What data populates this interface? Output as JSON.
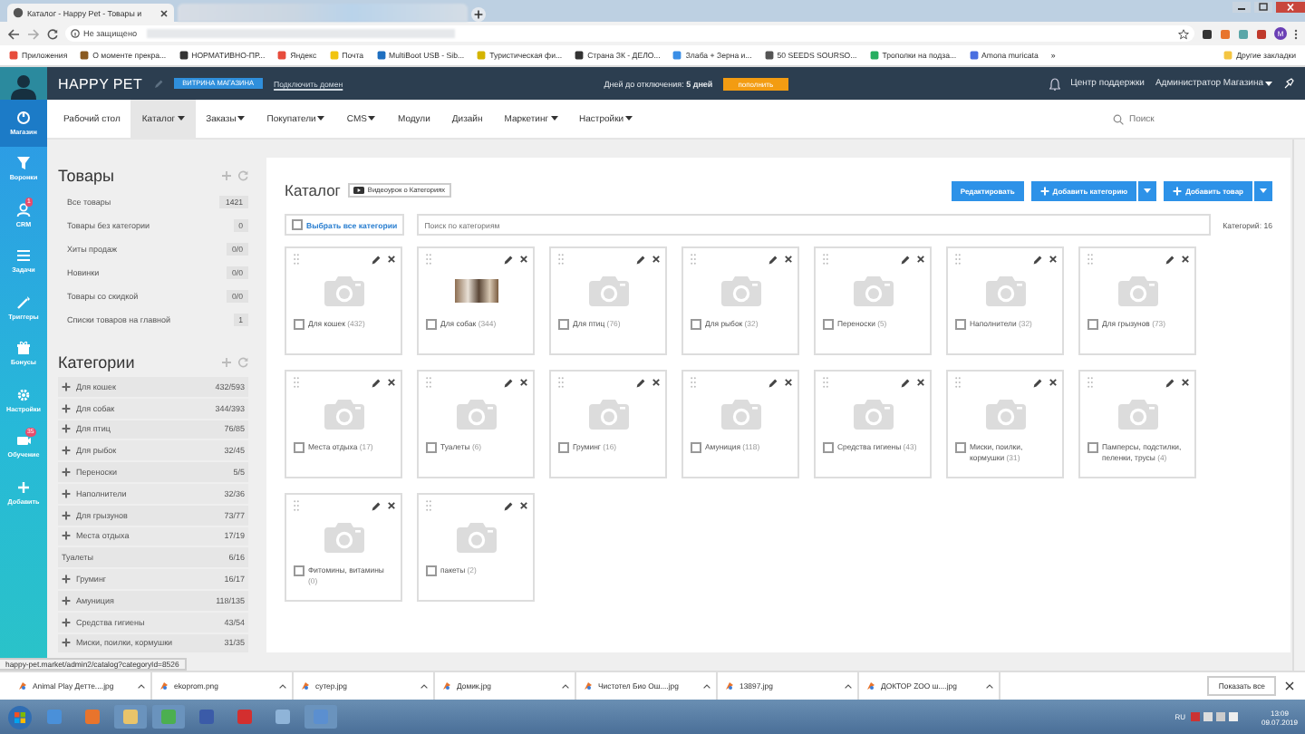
{
  "browser": {
    "tabs": [
      {
        "title": "Каталог - Happy Pet - Товары и",
        "selected": true
      }
    ],
    "security": "Не защищено",
    "profile": "M"
  },
  "bookmarks": [
    "Приложения",
    "О моменте прекра...",
    "НОРМАТИВНО-ПР...",
    "Яндекс",
    "Почта",
    "MultiBoot USB - Sib...",
    "Туристическая фи...",
    "Страна ЗК - ДЕЛО...",
    "Злаба + Зерна и...",
    "50 SEEDS SOURSO...",
    "Трополки на подза...",
    "Amona muricata",
    "»",
    "Другие закладки"
  ],
  "header": {
    "brand": "HAPPY PET",
    "storefront_button": "ВИТРИНА МАГАЗИНА",
    "domain_link": "Подключить домен",
    "days_left": "Дней до отключения: **5 дней**",
    "topup_button": "пополнить",
    "support": "Центр поддержки",
    "user": "Администратор Магазина"
  },
  "sidebar": [
    {
      "label": "Магазин",
      "selected": true
    },
    {
      "label": "Воронки",
      "selected": false
    },
    {
      "label": "CRM",
      "selected": false,
      "badge": "1"
    },
    {
      "label": "Задачи",
      "selected": false
    },
    {
      "label": "Триггеры",
      "selected": false
    },
    {
      "label": "Бонусы",
      "selected": false
    },
    {
      "label": "Настройки",
      "selected": false
    },
    {
      "label": "Обучение",
      "selected": false,
      "badge": "35"
    },
    {
      "label": "Добавить",
      "selected": false
    }
  ],
  "nav": {
    "items": [
      {
        "label": "Рабочий стол",
        "dropdown": false,
        "selected": false
      },
      {
        "label": "Каталог",
        "dropdown": true,
        "selected": true
      },
      {
        "label": "Заказы",
        "dropdown": true,
        "selected": false
      },
      {
        "label": "Покупатели",
        "dropdown": true,
        "selected": false
      },
      {
        "label": "CMS",
        "dropdown": true,
        "selected": false
      },
      {
        "label": "Модули",
        "dropdown": false,
        "selected": false
      },
      {
        "label": "Дизайн",
        "dropdown": false,
        "selected": false
      },
      {
        "label": "Маркетинг",
        "dropdown": true,
        "selected": false
      },
      {
        "label": "Настройки",
        "dropdown": true,
        "selected": false
      }
    ],
    "search_placeholder": "Поиск"
  },
  "products": {
    "title": "Товары",
    "items": [
      {
        "label": "Все товары",
        "count": "1421"
      },
      {
        "label": "Товары без категории",
        "count": "0"
      },
      {
        "label": "Хиты продаж",
        "count": "0/0"
      },
      {
        "label": "Новинки",
        "count": "0/0"
      },
      {
        "label": "Товары со скидкой",
        "count": "0/0"
      },
      {
        "label": "Списки товаров на главной",
        "count": "1"
      }
    ]
  },
  "categories": {
    "title": "Категории",
    "items": [
      {
        "label": "Для кошек",
        "count": "432/593",
        "expandable": true
      },
      {
        "label": "Для собак",
        "count": "344/393",
        "expandable": true
      },
      {
        "label": "Для птиц",
        "count": "76/85",
        "expandable": true
      },
      {
        "label": "Для рыбок",
        "count": "32/45",
        "expandable": true
      },
      {
        "label": "Переноски",
        "count": "5/5",
        "expandable": true
      },
      {
        "label": "Наполнители",
        "count": "32/36",
        "expandable": true
      },
      {
        "label": "Для грызунов",
        "count": "73/77",
        "expandable": true
      },
      {
        "label": "Места отдыха",
        "count": "17/19",
        "expandable": true
      },
      {
        "label": "Туалеты",
        "count": "6/16",
        "expandable": false
      },
      {
        "label": "Груминг",
        "count": "16/17",
        "expandable": true
      },
      {
        "label": "Амуниция",
        "count": "118/135",
        "expandable": true
      },
      {
        "label": "Средства гигиены",
        "count": "43/54",
        "expandable": true
      },
      {
        "label": "Миски, поилки, кормушки",
        "count": "31/35",
        "expandable": true
      }
    ]
  },
  "catalog": {
    "title": "Каталог",
    "video_button": "Видеоурок о Категориях",
    "edit_button": "Редактировать",
    "add_category": "Добавить категорию",
    "add_product": "Добавить товар",
    "select_all": {
      "label": "Выбрать все категории",
      "checked": false
    },
    "search_placeholder": "Поиск по категориям",
    "count_label": "Категорий: 16",
    "cards": [
      {
        "name": "Для кошек",
        "count": "(432)",
        "kind": "placeholder",
        "checked": false
      },
      {
        "name": "Для собак",
        "count": "(344)",
        "kind": "photo",
        "checked": false
      },
      {
        "name": "Для птиц",
        "count": "(76)",
        "kind": "placeholder",
        "checked": false
      },
      {
        "name": "Для рыбок",
        "count": "(32)",
        "kind": "placeholder",
        "checked": false
      },
      {
        "name": "Переноски",
        "count": "(5)",
        "kind": "placeholder",
        "checked": false
      },
      {
        "name": "Наполнители",
        "count": "(32)",
        "kind": "placeholder",
        "checked": false
      },
      {
        "name": "Для грызунов",
        "count": "(73)",
        "kind": "placeholder",
        "checked": false
      },
      {
        "name": "Места отдыха",
        "count": "(17)",
        "kind": "placeholder",
        "checked": false
      },
      {
        "name": "Туалеты",
        "count": "(6)",
        "kind": "placeholder",
        "checked": false
      },
      {
        "name": "Груминг",
        "count": "(16)",
        "kind": "placeholder",
        "checked": false
      },
      {
        "name": "Амуниция",
        "count": "(118)",
        "kind": "placeholder",
        "checked": false
      },
      {
        "name": "Средства гигиены",
        "count": "(43)",
        "kind": "placeholder",
        "checked": false
      },
      {
        "name": "Миски, поилки, кормушки",
        "count": "(31)",
        "kind": "placeholder",
        "checked": false
      },
      {
        "name": "Памперсы, подстилки, пеленки, трусы",
        "count": "(4)",
        "kind": "placeholder",
        "checked": false
      },
      {
        "name": "Фитомины, витамины",
        "count": "(0)",
        "kind": "placeholder",
        "checked": false
      },
      {
        "name": "пакеты",
        "count": "(2)",
        "kind": "placeholder",
        "checked": false
      }
    ]
  },
  "status_url": "happy-pet.market/admin2/catalog?categoryId=8526",
  "downloads": {
    "items": [
      "Animal Play Детте....jpg",
      "ekoprom.png",
      "сутер.jpg",
      "Домик.jpg",
      "Чистотел Био Ош....jpg",
      "13897.jpg",
      "ДОКТОР ZOO ш....jpg"
    ],
    "show_all": "Показать все"
  },
  "taskbar": {
    "language": "RU",
    "time": "13:09",
    "date": "09.07.2019"
  }
}
